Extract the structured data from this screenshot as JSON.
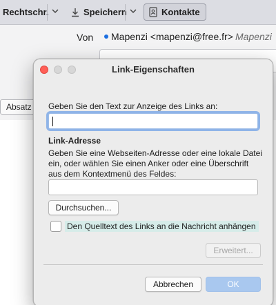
{
  "toolbar": {
    "spelling_label": "Rechtschr.",
    "save_label": "Speichern",
    "contacts_label": "Kontakte"
  },
  "compose": {
    "from_label": "Von",
    "from_value": "Mapenzi <mapenzi@free.fr>",
    "from_identity": "Mapenzi",
    "format_select": "Absatz"
  },
  "dialog": {
    "title": "Link-Eigenschaften",
    "text_prompt": "Geben Sie den Text zur Anzeige des Links an:",
    "text_value": "",
    "section_title": "Link-Adresse",
    "address_help": "Geben Sie eine Webseiten-Adresse oder eine lokale Datei ein, oder wählen Sie einen Anker oder eine Überschrift aus dem Kontextmenü des Feldes:",
    "address_value": "",
    "browse_label": "Durchsuchen...",
    "append_source_label": "Den Quelltext des Links an die Nachricht anhängen",
    "append_source_checked": false,
    "advanced_label": "Erweitert...",
    "cancel_label": "Abbrechen",
    "ok_label": "OK"
  },
  "colors": {
    "close_button": "#ff5f57",
    "focus_ring": "#4387e6",
    "ok_button": "#a9c8ef",
    "checkbox_highlight": "#d6ece9"
  }
}
